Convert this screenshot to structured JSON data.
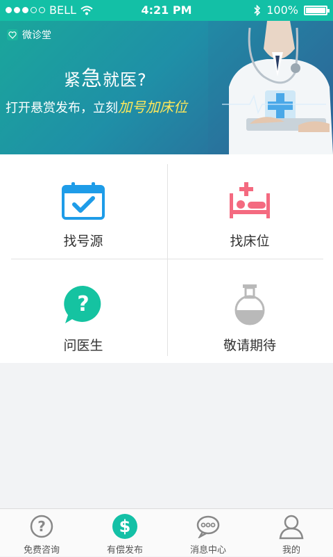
{
  "status_bar": {
    "carrier": "BELL",
    "time": "4:21 PM",
    "battery": "100%"
  },
  "banner": {
    "brand": "微诊堂",
    "headline_part1": "紧",
    "headline_part2": "急",
    "headline_part3": "就医?",
    "subline_prefix": "打开悬赏发布，立刻",
    "subline_highlight": "加号加床位"
  },
  "grid": {
    "items": [
      {
        "label": "找号源",
        "icon": "calendar-check-icon"
      },
      {
        "label": "找床位",
        "icon": "hospital-bed-icon"
      },
      {
        "label": "问医生",
        "icon": "question-bubble-icon"
      },
      {
        "label": "敬请期待",
        "icon": "flask-icon"
      }
    ]
  },
  "tabbar": {
    "tabs": [
      {
        "label": "免费咨询",
        "icon": "question-circle-icon"
      },
      {
        "label": "有偿发布",
        "icon": "dollar-circle-icon",
        "active": true
      },
      {
        "label": "消息中心",
        "icon": "chat-bubble-icon"
      },
      {
        "label": "我的",
        "icon": "person-icon"
      }
    ]
  },
  "colors": {
    "accent": "#13c0a6",
    "blue_icon": "#1e9ce8",
    "pink_icon": "#f46a80",
    "gray_icon": "#b9b9b9",
    "highlight": "#ffe85a"
  }
}
